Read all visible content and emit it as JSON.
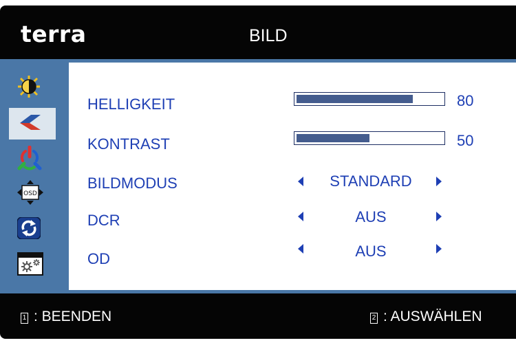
{
  "header": {
    "brand": "terra",
    "title": "BILD"
  },
  "sidebar": {
    "items": [
      {
        "icon": "brightness-contrast-icon",
        "active": false
      },
      {
        "icon": "picture-mode-icon",
        "active": true
      },
      {
        "icon": "color-rgb-icon",
        "active": false
      },
      {
        "icon": "osd-settings-icon",
        "active": false
      },
      {
        "icon": "reset-icon",
        "active": false
      },
      {
        "icon": "setup-icon",
        "active": false
      }
    ]
  },
  "menu": {
    "helligkeit": {
      "label": "HELLIGKEIT",
      "value": "80",
      "level": 80
    },
    "kontrast": {
      "label": "KONTRAST",
      "value": "50",
      "level": 50
    },
    "bildmodus": {
      "label": "BILDMODUS",
      "value": "STANDARD"
    },
    "dcr": {
      "label": "DCR",
      "value": "AUS"
    },
    "od": {
      "label": "OD",
      "value": "AUS"
    }
  },
  "footer": {
    "exit_key": "1",
    "exit_label": ": BEENDEN",
    "select_key": "2",
    "select_label": ": AUSWÄHLEN"
  },
  "colors": {
    "frame": "#050505",
    "accent": "#4a77a7",
    "text": "#1e3fb4",
    "bar_fill": "#445c8e",
    "active_item": "#dde6ee"
  }
}
